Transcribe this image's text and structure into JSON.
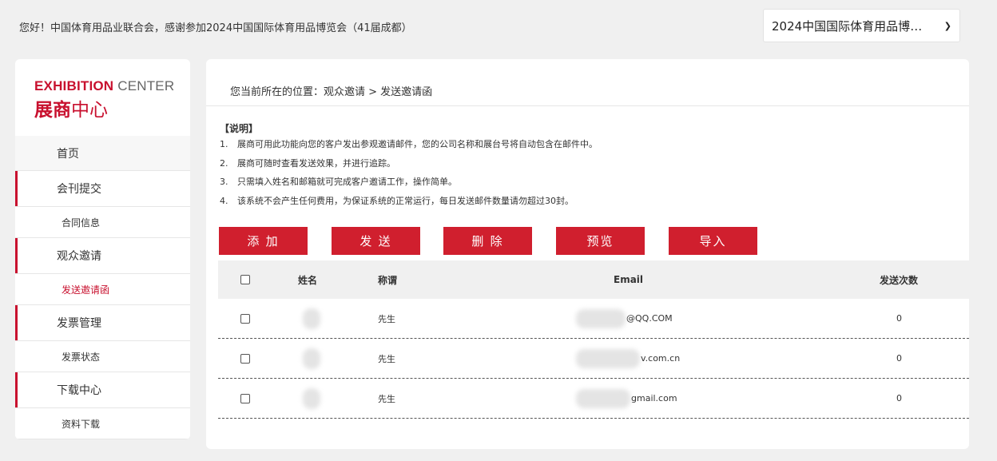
{
  "header": {
    "greeting": "您好！中国体育用品业联合会，感谢参加2024中国国际体育用品博览会（41届成都）",
    "expo_select_value": "2024中国国际体育用品博览…",
    "chevron_icon": "chevron-down-icon"
  },
  "sidebar": {
    "logo": {
      "line1_bold": "EXHIBITION",
      "line1_normal": " CENTER",
      "line2_a": "展商",
      "line2_b": "中心"
    },
    "items": [
      {
        "label": "首页"
      },
      {
        "label": "会刊提交"
      },
      {
        "label": "合同信息"
      },
      {
        "label": "观众邀请"
      },
      {
        "label": "发送邀请函"
      },
      {
        "label": "发票管理"
      },
      {
        "label": "发票状态"
      },
      {
        "label": "下载中心"
      },
      {
        "label": "资料下载"
      }
    ]
  },
  "main": {
    "breadcrumb": "您当前所在的位置：观众邀请 > 发送邀请函",
    "notes": {
      "title": "【说明】",
      "items": [
        {
          "num": "1.",
          "text": "展商可用此功能向您的客户发出参观邀请邮件，您的公司名称和展台号将自动包含在邮件中。"
        },
        {
          "num": "2.",
          "text": "展商可随时查看发送效果，并进行追踪。"
        },
        {
          "num": "3.",
          "text": "只需填入姓名和邮箱就可完成客户邀请工作，操作简单。"
        },
        {
          "num": "4.",
          "text": "该系统不会产生任何费用，为保证系统的正常运行，每日发送邮件数量请勿超过30封。"
        }
      ]
    },
    "buttons": {
      "add": "添 加",
      "send": "发 送",
      "delete": "删 除",
      "preview": "预览",
      "import": "导入"
    },
    "table": {
      "headers": {
        "name": "姓名",
        "title": "称谓",
        "email": "Email",
        "count": "发送次数"
      },
      "rows": [
        {
          "name": "",
          "title": "先生",
          "email": "@QQ.COM",
          "count": "0"
        },
        {
          "name": "",
          "title": "先生",
          "email": "v.com.cn",
          "count": "0"
        },
        {
          "name": "",
          "title": "先生",
          "email": "gmail.com",
          "count": "0"
        }
      ]
    }
  },
  "colors": {
    "brand_red": "#d01f2e",
    "text": "#333333"
  }
}
